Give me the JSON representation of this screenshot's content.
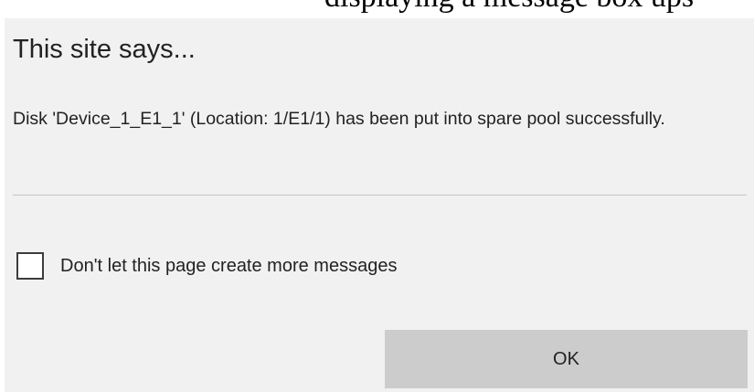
{
  "top_strip": {
    "partial_text": "displaying a message box ups"
  },
  "dialog": {
    "title": "This site says...",
    "message": "Disk 'Device_1_E1_1' (Location: 1/E1/1) has been put into spare pool successfully.",
    "suppress_checkbox": {
      "label": "Don't let this page create more messages",
      "checked": false
    },
    "ok_label": "OK"
  },
  "colors": {
    "dialog_background": "#f1f1f1",
    "button_background": "#cccccc",
    "text": "#222222",
    "divider": "#c4c4c4"
  }
}
